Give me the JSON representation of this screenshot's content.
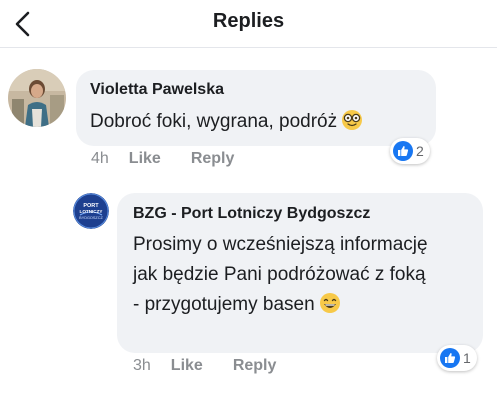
{
  "header": {
    "title": "Replies",
    "back_icon": "chevron-left-icon"
  },
  "colors": {
    "like_blue": "#1877f2",
    "bubble_bg": "#f0f2f5",
    "meta_gray": "#8a8d91",
    "text_dark": "#1c1e21"
  },
  "comments": [
    {
      "author": "Violetta Pawelska",
      "text": "Dobroć foki, wygrana, podróż",
      "emoji": "nerd-glasses-emoji",
      "time": "4h",
      "like_label": "Like",
      "reply_label": "Reply",
      "reaction_count": "2"
    },
    {
      "author": "BZG - Port Lotniczy Bydgoszcz",
      "text": "Prosimy o wcześniejszą informację jak będzie Pani podróżować z foką - przygotujemy basen",
      "emoji": "grinning-smile-emoji",
      "time": "3h",
      "like_label": "Like",
      "reply_label": "Reply",
      "reaction_count": "1",
      "avatar_logo_text": [
        "PORT",
        "LOTNICZY",
        "BYDGOSZCZ"
      ]
    }
  ]
}
